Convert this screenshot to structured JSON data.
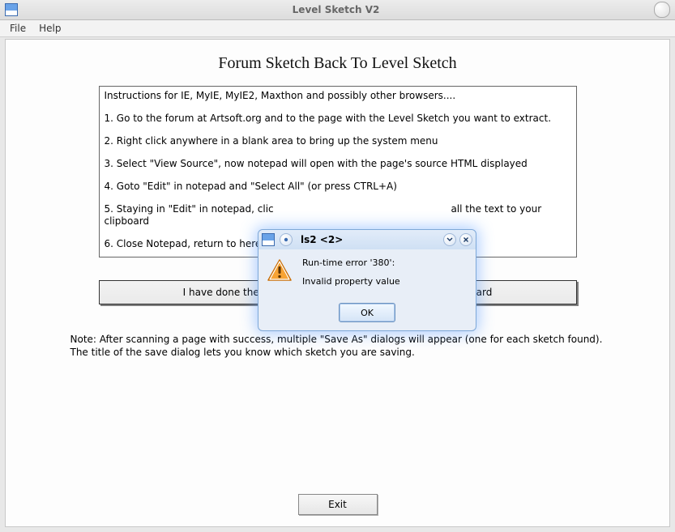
{
  "window": {
    "title": "Level Sketch V2"
  },
  "menu": {
    "file": "File",
    "help": "Help"
  },
  "heading": "Forum Sketch Back To Level Sketch",
  "instructions": {
    "intro": "Instructions for IE, MyIE, MyIE2, Maxthon and possibly other browsers....",
    "step1": "1. Go to the forum at Artsoft.org and to the page with the Level Sketch you want to extract.",
    "step2": "2. Right click anywhere in a blank area to bring up the system menu",
    "step3": "3. Select \"View Source\", now notepad will open with the page's source HTML displayed",
    "step4": "4. Goto \"Edit\" in notepad and \"Select All\" (or press CTRL+A)",
    "step5_pre": "5. Staying in \"Edit\" in notepad, clic",
    "step5_post": " all the text to your clipboard",
    "step6": "6. Close Notepad,  return to here a"
  },
  "clipboard_button": "I have done the above and the page's source is in my clipboard",
  "note": "Note:  After scanning a page with success, multiple \"Save As\" dialogs will appear (one for each sketch found). The title of the save dialog lets you know which sketch you are saving.",
  "exit_button": "Exit",
  "dialog": {
    "title": "ls2 <2>",
    "line1": "Run-time error '380':",
    "line2": "Invalid property value",
    "ok": "OK"
  }
}
